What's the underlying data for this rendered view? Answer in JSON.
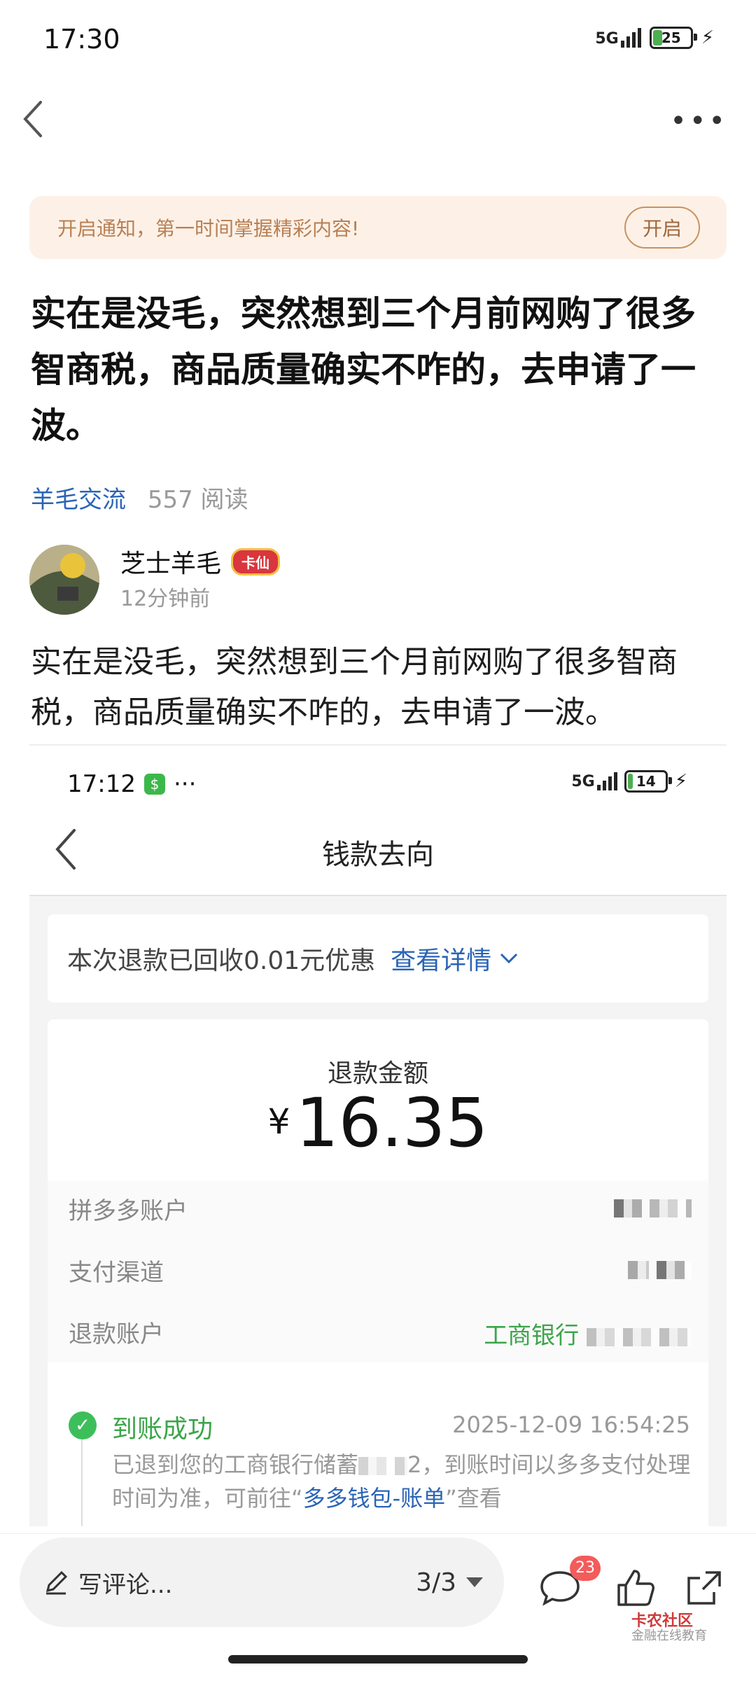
{
  "status_bar": {
    "time": "17:30",
    "network": "5G",
    "battery": "25",
    "battery_fraction": 0.25
  },
  "notify": {
    "text": "开启通知，第一时间掌握精彩内容!",
    "button": "开启"
  },
  "post": {
    "title": "实在是没毛，突然想到三个月前网购了很多智商税，商品质量确实不咋的，去申请了一波。",
    "category": "羊毛交流",
    "reads": "557 阅读",
    "author": "芝士羊毛",
    "badge": "卡仙",
    "time": "12分钟前",
    "body": "实在是没毛，突然想到三个月前网购了很多智商税，商品质量确实不咋的，去申请了一波。"
  },
  "screenshot": {
    "status_time": "17:12",
    "status_more": "···",
    "network": "5G",
    "battery": "14",
    "battery_fraction": 0.14,
    "page_title": "钱款去向",
    "coupon_text": "本次退款已回收0.01元优惠",
    "coupon_link": "查看详情",
    "refund_label": "退款金额",
    "currency": "¥",
    "refund_amount": "16.35",
    "rows": [
      {
        "label": "拼多多账户",
        "value": ""
      },
      {
        "label": "支付渠道",
        "value": ""
      },
      {
        "label": "退款账户",
        "value": "工商银行"
      }
    ],
    "status_title": "到账成功",
    "status_date": "2025-12-09 16:54:25",
    "status_desc_1": "已退到您的工商银行储蓄",
    "status_desc_2": "2，到账时间以多多支付处理时间为准，可前往“",
    "status_desc_link": "多多钱包-账单",
    "status_desc_3": "”查看"
  },
  "bottom_bar": {
    "comment_placeholder": "写评论...",
    "pager": "3/3",
    "comment_count": "23",
    "watermark_title": "卡农社区",
    "watermark_sub": "金融在线教育"
  },
  "colors": {
    "accent_blue": "#2a64b6",
    "success_green": "#3ca54a",
    "badge_red": "#f45b5b",
    "notify_bg": "#fdf1e7"
  }
}
